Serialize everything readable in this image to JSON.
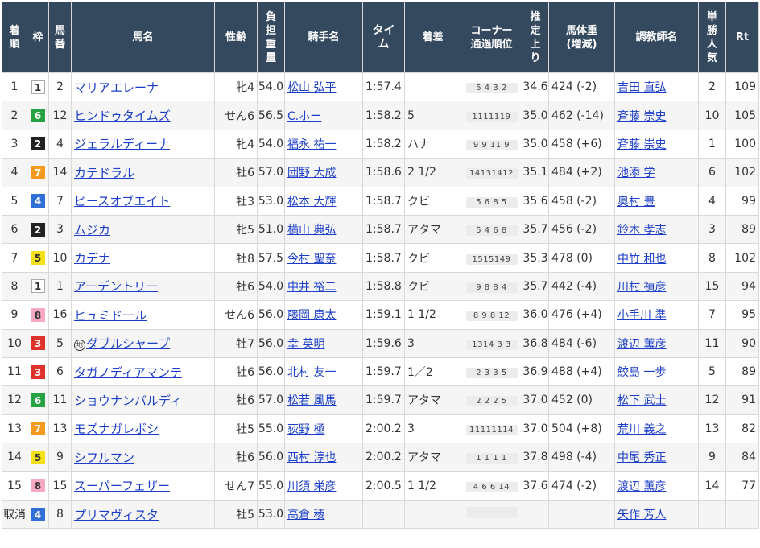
{
  "headers": {
    "pos": [
      "着",
      "順"
    ],
    "waku": [
      "枠"
    ],
    "num": [
      "馬",
      "番"
    ],
    "horse": [
      "馬名"
    ],
    "sexage": [
      "性齢"
    ],
    "weight": [
      "負",
      "担",
      "重",
      "量"
    ],
    "jockey": [
      "騎手名"
    ],
    "time": [
      "タイ",
      "ム"
    ],
    "margin": [
      "着差"
    ],
    "corner": [
      "コーナー",
      "通過順位"
    ],
    "last3f": [
      "推",
      "定",
      "上",
      "り"
    ],
    "bodyweight": [
      "馬体重",
      "(増減)"
    ],
    "trainer": [
      "調教師名"
    ],
    "pop": [
      "単",
      "勝",
      "人",
      "気"
    ],
    "rt": [
      "Rt"
    ]
  },
  "waku_colors": {
    "1": {
      "bg": "#ffffff",
      "fg": "#333333"
    },
    "2": {
      "bg": "#222222",
      "fg": "#ffffff"
    },
    "3": {
      "bg": "#e0312b",
      "fg": "#ffffff"
    },
    "4": {
      "bg": "#2f6fd6",
      "fg": "#ffffff"
    },
    "5": {
      "bg": "#f5e019",
      "fg": "#333333"
    },
    "6": {
      "bg": "#27a243",
      "fg": "#ffffff"
    },
    "7": {
      "bg": "#f59a1e",
      "fg": "#ffffff"
    },
    "8": {
      "bg": "#f7a8c4",
      "fg": "#333333"
    }
  },
  "rows": [
    {
      "pos": "1",
      "waku": "1",
      "num": "2",
      "horse": "マリアエレーナ",
      "local": false,
      "sexage": "牝4",
      "weight": "54.0",
      "jockey": "松山 弘平",
      "time": "1:57.4",
      "margin": "",
      "corner": "5 4 3 2",
      "last3f": "34.6",
      "bodyweight": "424 (-2)",
      "trainer": "吉田 直弘",
      "pop": "2",
      "rt": "109"
    },
    {
      "pos": "2",
      "waku": "6",
      "num": "12",
      "horse": "ヒンドゥタイムズ",
      "local": false,
      "sexage": "せん6",
      "weight": "56.5",
      "jockey": "C.ホー",
      "time": "1:58.2",
      "margin": "5",
      "corner": "1111119",
      "last3f": "35.0",
      "bodyweight": "462 (-14)",
      "trainer": "斉藤 崇史",
      "pop": "10",
      "rt": "105"
    },
    {
      "pos": "3",
      "waku": "2",
      "num": "4",
      "horse": "ジェラルディーナ",
      "local": false,
      "sexage": "牝4",
      "weight": "54.0",
      "jockey": "福永 祐一",
      "time": "1:58.2",
      "margin": "ハナ",
      "corner": "9 9 11 9",
      "last3f": "35.0",
      "bodyweight": "458 (+6)",
      "trainer": "斉藤 崇史",
      "pop": "1",
      "rt": "100"
    },
    {
      "pos": "4",
      "waku": "7",
      "num": "14",
      "horse": "カテドラル",
      "local": false,
      "sexage": "牡6",
      "weight": "57.0",
      "jockey": "団野 大成",
      "time": "1:58.6",
      "margin": "2 1/2",
      "corner": "14131412",
      "last3f": "35.1",
      "bodyweight": "484 (+2)",
      "trainer": "池添 学",
      "pop": "6",
      "rt": "102"
    },
    {
      "pos": "5",
      "waku": "4",
      "num": "7",
      "horse": "ピースオブエイト",
      "local": false,
      "sexage": "牡3",
      "weight": "53.0",
      "jockey": "松本 大輝",
      "time": "1:58.7",
      "margin": "クビ",
      "corner": "5 6 8 5",
      "last3f": "35.6",
      "bodyweight": "458 (-2)",
      "trainer": "奥村 豊",
      "pop": "4",
      "rt": "99"
    },
    {
      "pos": "6",
      "waku": "2",
      "num": "3",
      "horse": "ムジカ",
      "local": false,
      "sexage": "牝5",
      "weight": "51.0",
      "jockey": "横山 典弘",
      "time": "1:58.7",
      "margin": "アタマ",
      "corner": "5 4 6 8",
      "last3f": "35.7",
      "bodyweight": "456 (-2)",
      "trainer": "鈴木 孝志",
      "pop": "3",
      "rt": "89"
    },
    {
      "pos": "7",
      "waku": "5",
      "num": "10",
      "horse": "カデナ",
      "local": false,
      "sexage": "牡8",
      "weight": "57.5",
      "jockey": "今村 聖奈",
      "time": "1:58.7",
      "margin": "クビ",
      "corner": "1515149",
      "last3f": "35.3",
      "bodyweight": "478 (0)",
      "trainer": "中竹 和也",
      "pop": "8",
      "rt": "102"
    },
    {
      "pos": "8",
      "waku": "1",
      "num": "1",
      "horse": "アーデントリー",
      "local": false,
      "sexage": "牡6",
      "weight": "54.0",
      "jockey": "中井 裕二",
      "time": "1:58.8",
      "margin": "クビ",
      "corner": "9 8 8 4",
      "last3f": "35.7",
      "bodyweight": "442 (-4)",
      "trainer": "川村 禎彦",
      "pop": "15",
      "rt": "94"
    },
    {
      "pos": "9",
      "waku": "8",
      "num": "16",
      "horse": "ヒュミドール",
      "local": false,
      "sexage": "せん6",
      "weight": "56.0",
      "jockey": "藤岡 康太",
      "time": "1:59.1",
      "margin": "1 1/2",
      "corner": "8 9 8 12",
      "last3f": "36.0",
      "bodyweight": "476 (+4)",
      "trainer": "小手川 準",
      "pop": "7",
      "rt": "95"
    },
    {
      "pos": "10",
      "waku": "3",
      "num": "5",
      "horse": "ダブルシャープ",
      "local": true,
      "sexage": "牡7",
      "weight": "56.0",
      "jockey": "幸 英明",
      "time": "1:59.6",
      "margin": "3",
      "corner": "1314 3 3",
      "last3f": "36.8",
      "bodyweight": "484 (-6)",
      "trainer": "渡辺 薫彦",
      "pop": "11",
      "rt": "90"
    },
    {
      "pos": "11",
      "waku": "3",
      "num": "6",
      "horse": "タガノディアマンテ",
      "local": false,
      "sexage": "牡6",
      "weight": "56.0",
      "jockey": "北村 友一",
      "time": "1:59.7",
      "margin": "1／2",
      "corner": "2 3 3 5",
      "last3f": "36.9",
      "bodyweight": "488 (+4)",
      "trainer": "鮫島 一歩",
      "pop": "5",
      "rt": "89"
    },
    {
      "pos": "12",
      "waku": "6",
      "num": "11",
      "horse": "ショウナンバルディ",
      "local": false,
      "sexage": "牡6",
      "weight": "57.0",
      "jockey": "松若 風馬",
      "time": "1:59.7",
      "margin": "アタマ",
      "corner": "2 2 2 5",
      "last3f": "37.0",
      "bodyweight": "452 (0)",
      "trainer": "松下 武士",
      "pop": "12",
      "rt": "91"
    },
    {
      "pos": "13",
      "waku": "7",
      "num": "13",
      "horse": "モズナガレボシ",
      "local": false,
      "sexage": "牡5",
      "weight": "55.0",
      "jockey": "荻野 極",
      "time": "2:00.2",
      "margin": "3",
      "corner": "11111114",
      "last3f": "37.0",
      "bodyweight": "504 (+8)",
      "trainer": "荒川 義之",
      "pop": "13",
      "rt": "82"
    },
    {
      "pos": "14",
      "waku": "5",
      "num": "9",
      "horse": "シフルマン",
      "local": false,
      "sexage": "牡6",
      "weight": "56.0",
      "jockey": "西村 淳也",
      "time": "2:00.2",
      "margin": "アタマ",
      "corner": "1 1 1 1",
      "last3f": "37.8",
      "bodyweight": "498 (-4)",
      "trainer": "中尾 秀正",
      "pop": "9",
      "rt": "84"
    },
    {
      "pos": "15",
      "waku": "8",
      "num": "15",
      "horse": "スーパーフェザー",
      "local": false,
      "sexage": "せん7",
      "weight": "55.0",
      "jockey": "川須 栄彦",
      "time": "2:00.5",
      "margin": "1 1/2",
      "corner": "4 6 6 14",
      "last3f": "37.6",
      "bodyweight": "474 (-2)",
      "trainer": "渡辺 薫彦",
      "pop": "14",
      "rt": "77"
    },
    {
      "pos": "取消",
      "waku": "4",
      "num": "8",
      "horse": "プリマヴィスタ",
      "local": false,
      "sexage": "牡5",
      "weight": "53.0",
      "jockey": "高倉 稜",
      "time": "",
      "margin": "",
      "corner": "",
      "last3f": "",
      "bodyweight": "",
      "trainer": "矢作 芳人",
      "pop": "",
      "rt": ""
    }
  ],
  "local_mark": "地"
}
